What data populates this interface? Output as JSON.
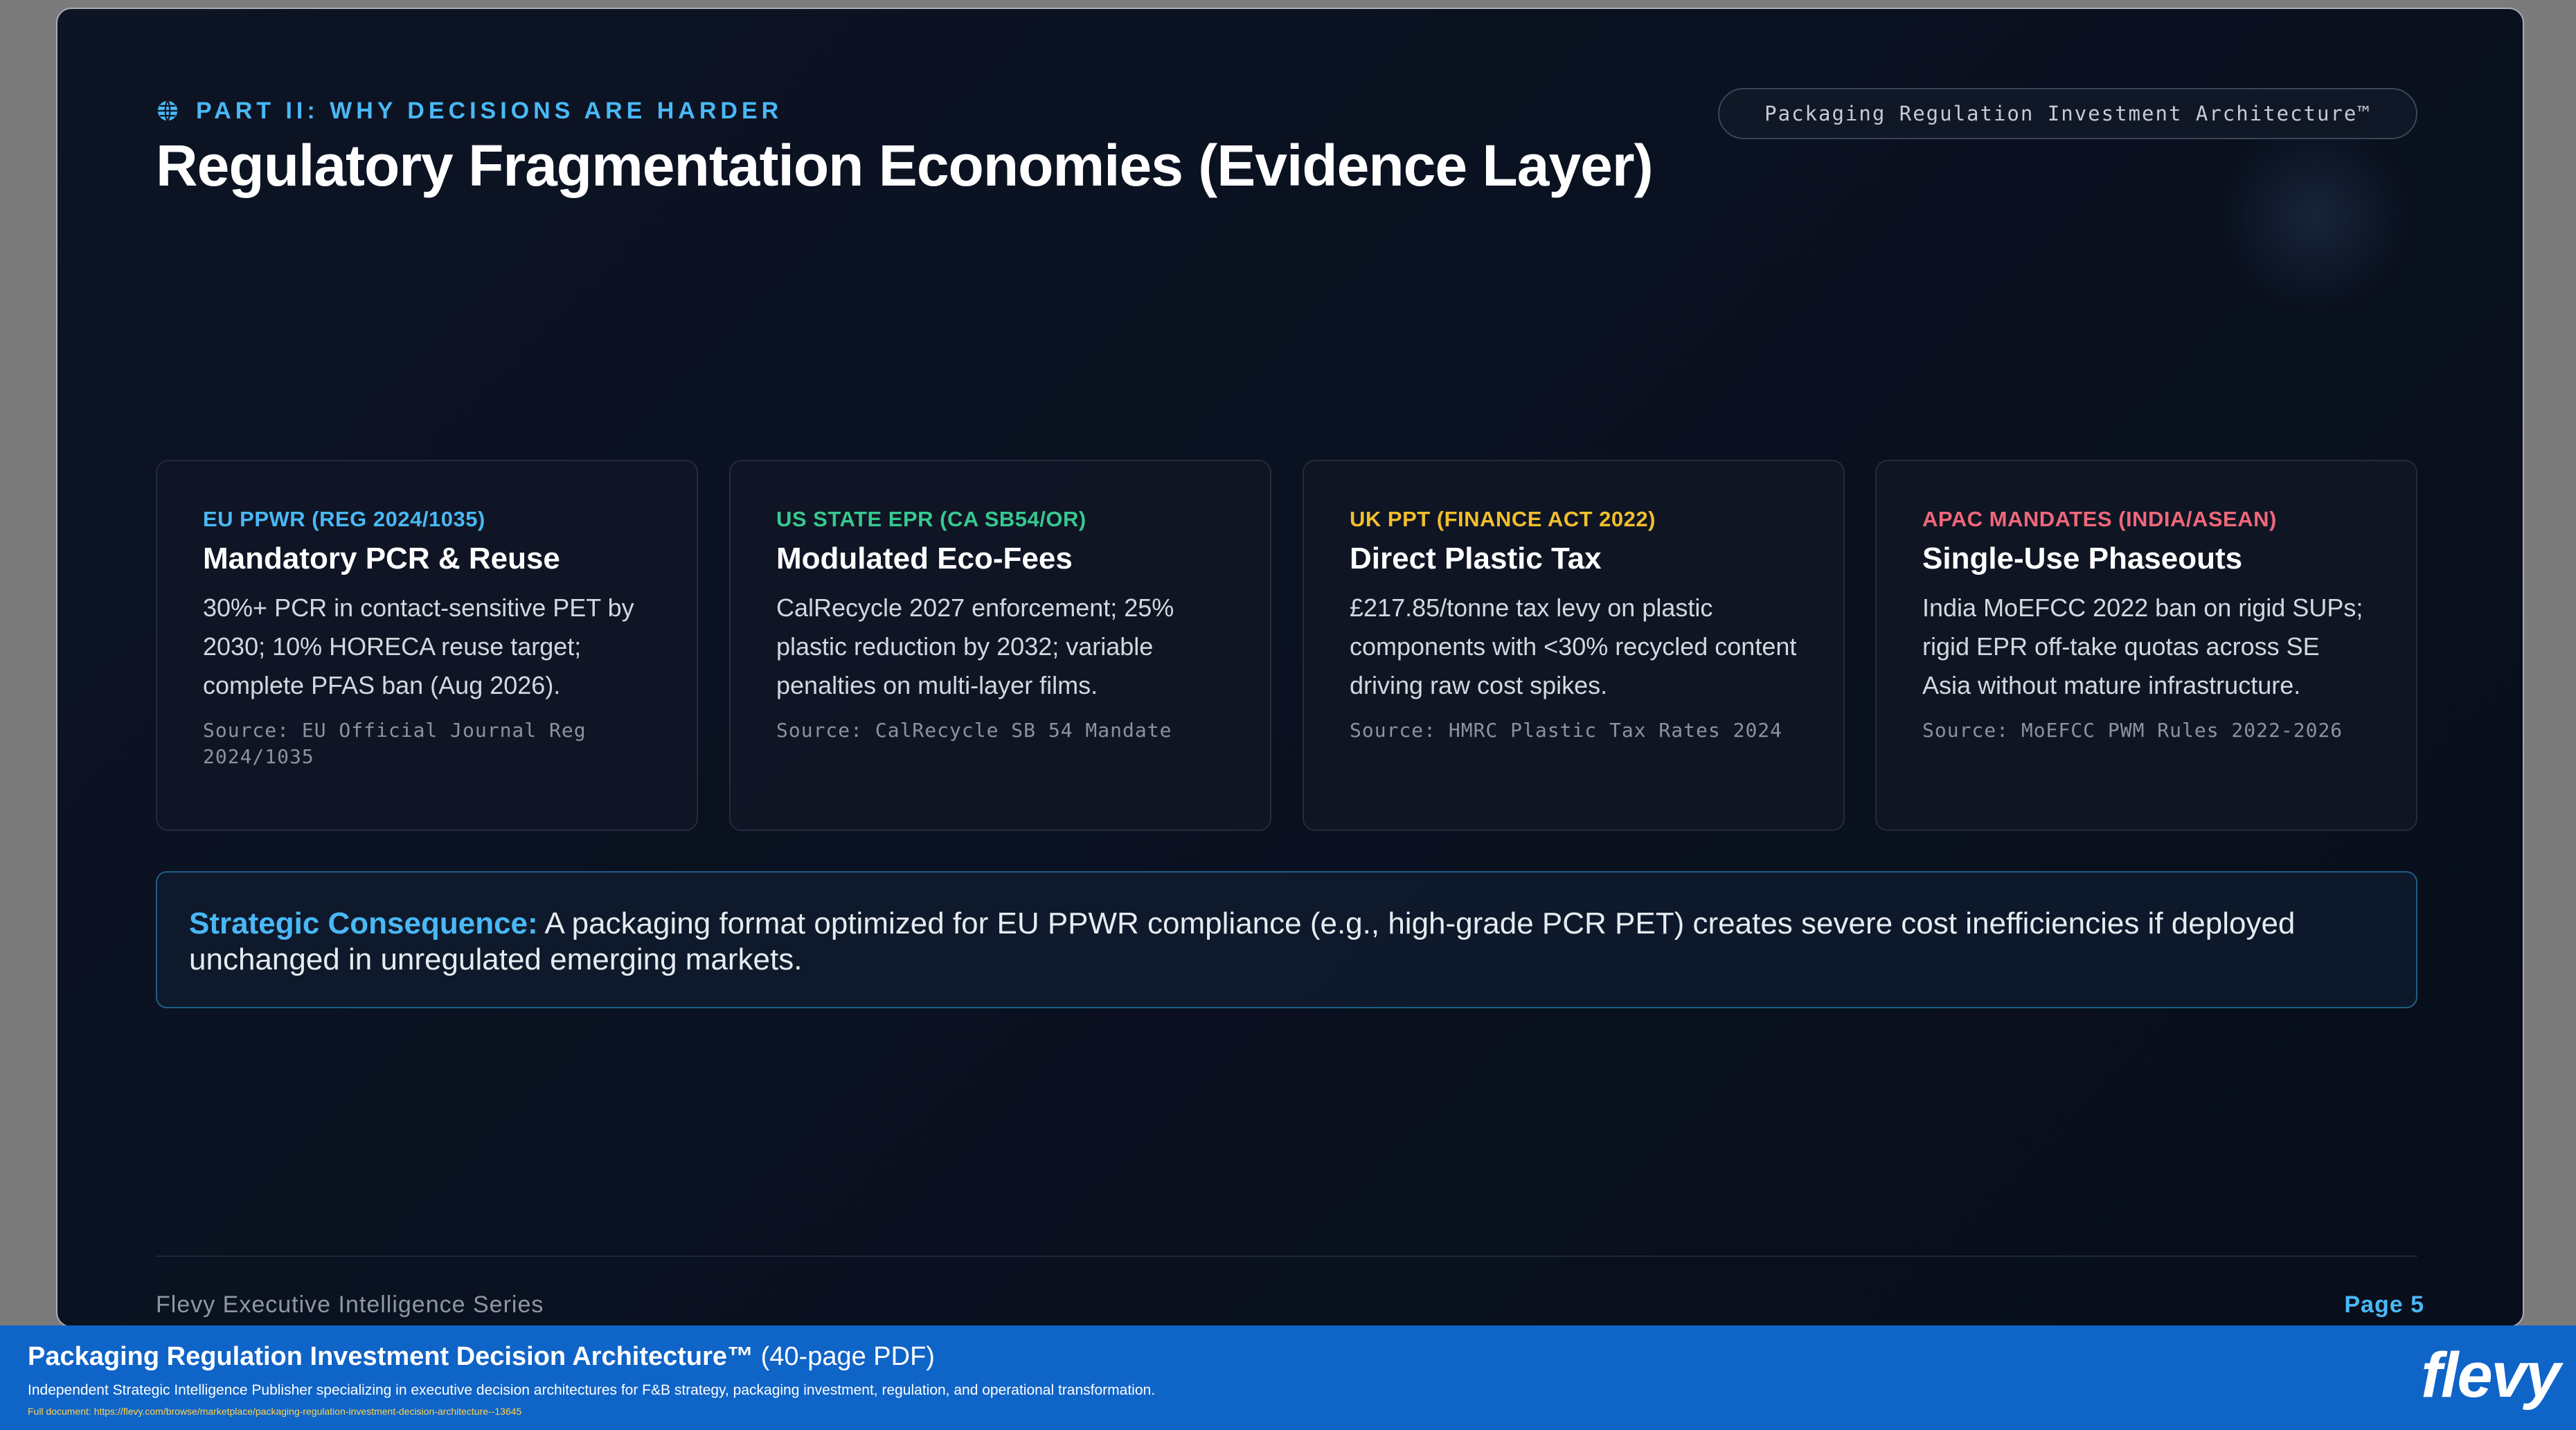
{
  "header": {
    "part_label": "PART II: WHY DECISIONS ARE HARDER",
    "title": "Regulatory Fragmentation Economies (Evidence Layer)",
    "badge": "Packaging Regulation Investment Architecture™"
  },
  "cards": [
    {
      "tag": "EU PPWR (REG 2024/1035)",
      "tag_color": "#4ab8f5",
      "heading": "Mandatory PCR & Reuse",
      "body": "30%+ PCR in contact-sensitive PET by 2030; 10% HORECA reuse target; complete PFAS ban (Aug 2026).",
      "source": "Source: EU Official Journal Reg 2024/1035"
    },
    {
      "tag": "US STATE EPR (CA SB54/OR)",
      "tag_color": "#37c98f",
      "heading": "Modulated Eco-Fees",
      "body": "CalRecycle 2027 enforcement; 25% plastic reduction by 2032; variable penalties on multi-layer films.",
      "source": "Source: CalRecycle SB 54 Mandate"
    },
    {
      "tag": "UK PPT (FINANCE ACT 2022)",
      "tag_color": "#f2bf2c",
      "heading": "Direct Plastic Tax",
      "body": "£217.85/tonne tax levy on plastic components with <30% recycled content driving raw cost spikes.",
      "source": "Source: HMRC Plastic Tax Rates 2024"
    },
    {
      "tag": "APAC MANDATES (INDIA/ASEAN)",
      "tag_color": "#f0677a",
      "heading": "Single-Use Phaseouts",
      "body": "India MoEFCC 2022 ban on rigid SUPs; rigid EPR off-take quotas across SE Asia without mature infrastructure.",
      "source": "Source: MoEFCC PWM Rules 2022-2026"
    }
  ],
  "callout": {
    "lead": "Strategic Consequence:",
    "text": " A packaging format optimized for EU PPWR compliance (e.g., high-grade PCR PET) creates severe cost inefficiencies if deployed unchanged in unregulated emerging markets."
  },
  "footer": {
    "series": "Flevy Executive Intelligence Series",
    "page": "Page 5"
  },
  "banner": {
    "title": "Packaging Regulation Investment Decision Architecture™",
    "pages": " (40-page PDF)",
    "description": "Independent Strategic Intelligence Publisher specializing in executive decision architectures for F&B strategy, packaging investment, regulation, and operational transformation.",
    "url": "Full document: https://flevy.com/browse/marketplace/packaging-regulation-investment-decision-architecture--13645",
    "logo": "flevy"
  }
}
